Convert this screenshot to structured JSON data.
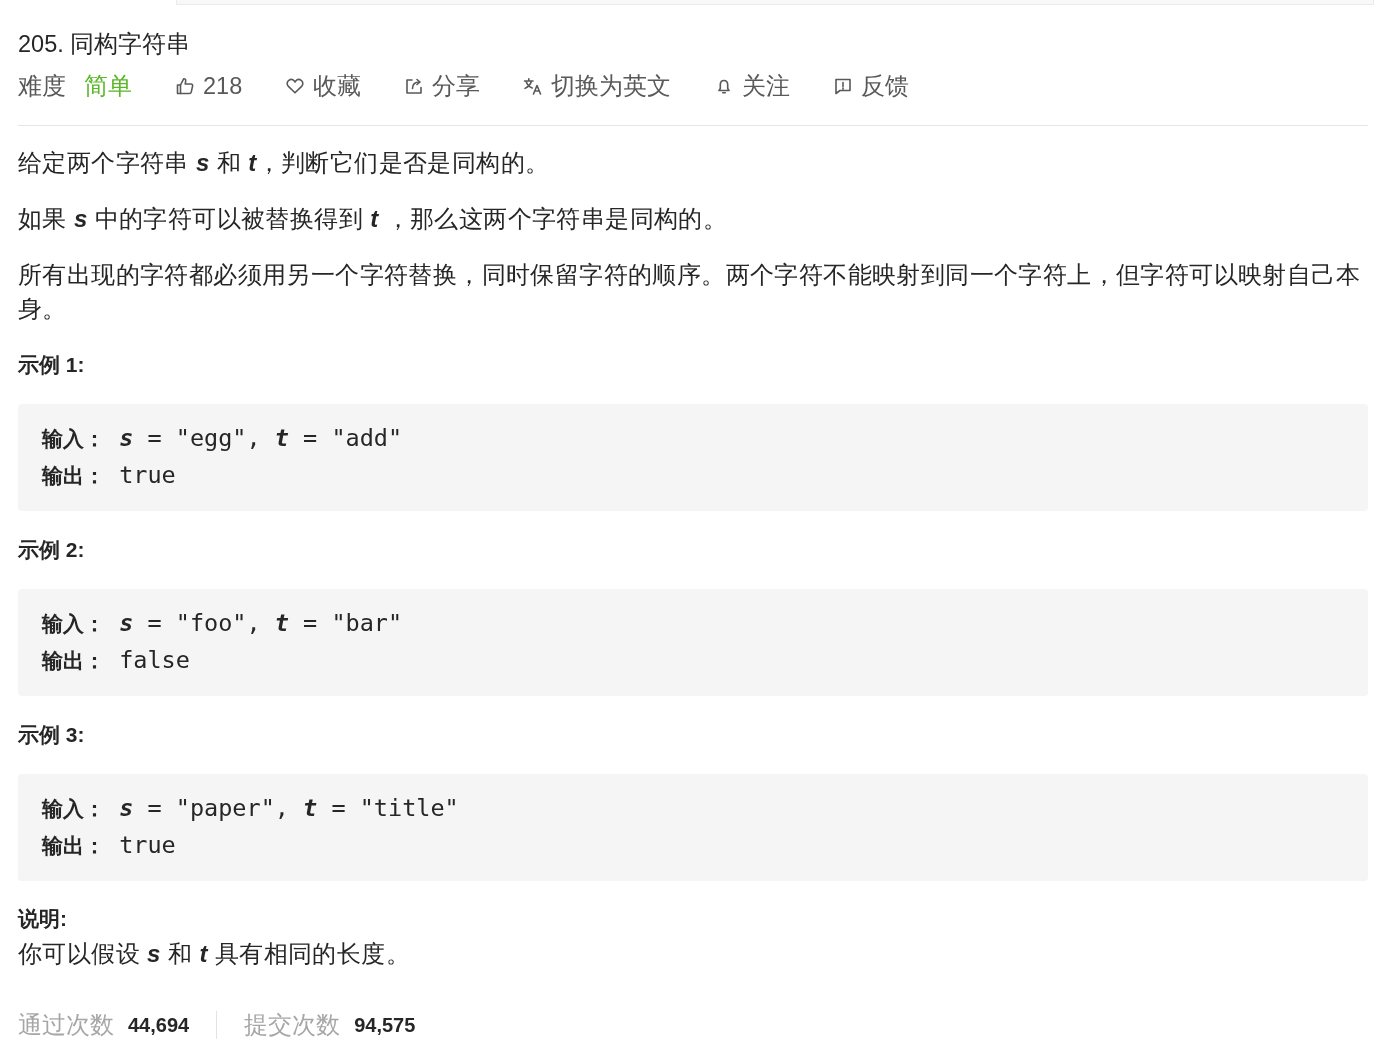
{
  "problem": {
    "title": "205. 同构字符串",
    "difficulty": {
      "label": "难度",
      "value": "简单",
      "kind": "easy"
    },
    "actions": [
      {
        "kind": "like",
        "label": "218"
      },
      {
        "kind": "favorite",
        "label": "收藏"
      },
      {
        "kind": "share",
        "label": "分享"
      },
      {
        "kind": "translate",
        "label": "切换为英文"
      },
      {
        "kind": "follow",
        "label": "关注"
      },
      {
        "kind": "feedback",
        "label": "反馈"
      }
    ]
  },
  "description": [
    "给定两个字符串 *s* 和 *t*，判断它们是否是同构的。",
    "如果 *s* 中的字符可以被替换得到 *t* ，那么这两个字符串是同构的。",
    "所有出现的字符都必须用另一个字符替换，同时保留字符的顺序。两个字符不能映射到同一个字符上，但字符可以映射自己本身。"
  ],
  "examples": [
    {
      "title": "示例 1:",
      "lines": [
        "**输入：** *s* = \"egg\", *t* = \"add\"",
        "**输出：** true"
      ]
    },
    {
      "title": "示例 2:",
      "lines": [
        "**输入：** *s* = \"foo\", *t* = \"bar\"",
        "**输出：** false"
      ]
    },
    {
      "title": "示例 3:",
      "lines": [
        "**输入：** *s* = \"paper\", *t* = \"title\"",
        "**输出：** true"
      ]
    }
  ],
  "note": {
    "title": "说明:",
    "text": "你可以假设 *s* 和 *t* 具有相同的长度。"
  },
  "stats": [
    {
      "label": "通过次数",
      "value": "44,694"
    },
    {
      "label": "提交次数",
      "value": "94,575"
    }
  ]
}
